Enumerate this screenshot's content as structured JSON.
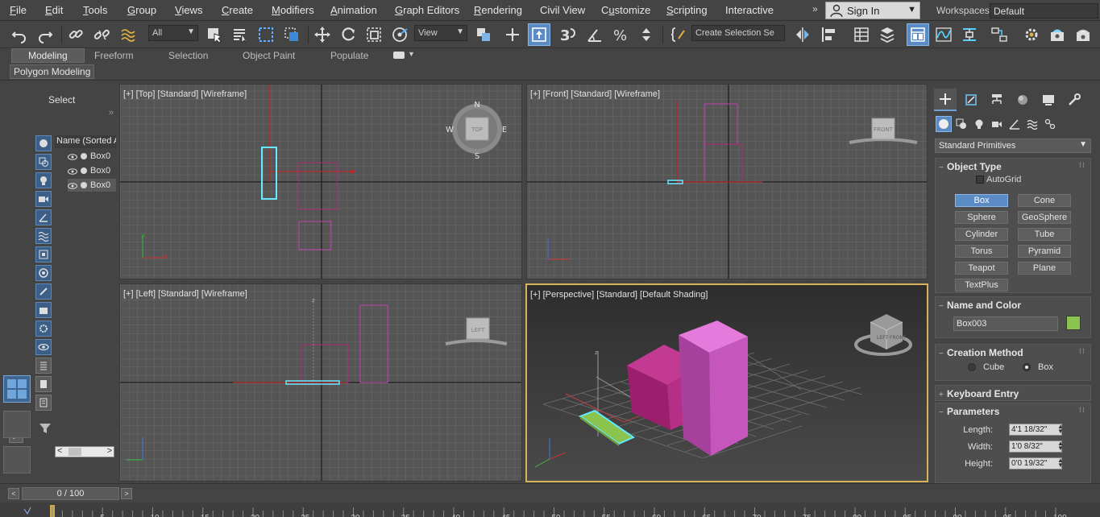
{
  "menu": {
    "items": [
      {
        "label": "File",
        "hot": "F"
      },
      {
        "label": "Edit",
        "hot": "E"
      },
      {
        "label": "Tools",
        "hot": "T"
      },
      {
        "label": "Group",
        "hot": "G"
      },
      {
        "label": "Views",
        "hot": "V"
      },
      {
        "label": "Create",
        "hot": "C"
      },
      {
        "label": "Modifiers",
        "hot": "M"
      },
      {
        "label": "Animation",
        "hot": "A"
      },
      {
        "label": "Graph Editors",
        "hot": "G"
      },
      {
        "label": "Rendering",
        "hot": "R"
      },
      {
        "label": "Civil View",
        "hot": ""
      },
      {
        "label": "Customize",
        "hot": "u"
      },
      {
        "label": "Scripting",
        "hot": "S"
      },
      {
        "label": "Interactive",
        "hot": ""
      }
    ],
    "overflow": "»",
    "signin": "Sign In",
    "workspaces_label": "Workspaces:",
    "workspaces_value": "Default"
  },
  "toolbar": {
    "filter_select": "All",
    "view_select": "View",
    "selection_set": "Create Selection Se",
    "snap_3": "3",
    "icons": [
      "undo-icon",
      "redo-icon",
      "link-icon",
      "unlink-icon",
      "bind-spacewarp-icon",
      "select-object-icon",
      "select-by-name-icon",
      "rect-region-icon",
      "window-crossing-icon",
      "move-icon",
      "rotate-icon",
      "scale-icon",
      "placement-icon",
      "pivot-icon",
      "manipulate-icon",
      "keyboard-shortcut-icon",
      "snap-toggle-icon",
      "angle-snap-icon",
      "percent-snap-icon",
      "spinner-snap-icon",
      "edit-named-sets-icon",
      "mirror-icon",
      "align-icon",
      "scene-explorer-icon",
      "layer-explorer-icon",
      "toggle-ribbon-icon",
      "curve-editor-icon",
      "schematic-view-icon",
      "material-editor-icon",
      "render-setup-icon",
      "rendered-frame-icon",
      "render-icon",
      "render-cloud-icon"
    ]
  },
  "ribbon": {
    "tabs": [
      "Modeling",
      "Freeform",
      "Selection",
      "Object Paint",
      "Populate"
    ],
    "active": "Modeling",
    "sub_label": "Polygon Modeling"
  },
  "explorer": {
    "title": "Select",
    "column_header": "Name (Sorted A",
    "rows": [
      "Box0",
      "Box0",
      "Box0"
    ],
    "selected_index": 2
  },
  "viewports": {
    "top": "[+] [Top] [Standard] [Wireframe]",
    "front": "[+] [Front] [Standard] [Wireframe]",
    "left": "[+] [Left] [Standard] [Wireframe]",
    "perspective": "[+] [Perspective] [Standard] [Default Shading]",
    "compass": {
      "n": "N",
      "s": "S",
      "e": "E",
      "w": "W",
      "cube_top": "TOP"
    },
    "viewcube_front": "FRONT",
    "viewcube_left": "LEFT",
    "viewcube_persp": [
      "LEFT",
      "FRONT"
    ],
    "axis_labels": {
      "x": "x",
      "y": "y",
      "z": "z"
    }
  },
  "command_panel": {
    "category_dropdown": "Standard Primitives",
    "object_type": {
      "title": "Object Type",
      "autogrid": "AutoGrid",
      "buttons": [
        "Box",
        "Cone",
        "Sphere",
        "GeoSphere",
        "Cylinder",
        "Tube",
        "Torus",
        "Pyramid",
        "Teapot",
        "Plane",
        "TextPlus"
      ],
      "active": "Box"
    },
    "name_and_color": {
      "title": "Name and Color",
      "name": "Box003",
      "color": "#8ac44f"
    },
    "creation_method": {
      "title": "Creation Method",
      "options": [
        "Cube",
        "Box"
      ],
      "selected": "Box"
    },
    "keyboard_entry": {
      "title": "Keyboard Entry"
    },
    "parameters": {
      "title": "Parameters",
      "fields": [
        {
          "label": "Length:",
          "value": "4'1 18/32\""
        },
        {
          "label": "Width:",
          "value": "1'0 8/32\""
        },
        {
          "label": "Height:",
          "value": "0'0 19/32\""
        }
      ]
    }
  },
  "timeline": {
    "slider": "0 / 100",
    "prev": "<",
    "next": ">",
    "ruler_labels": [
      "5",
      "10",
      "15",
      "20",
      "25",
      "30",
      "35",
      "40",
      "45",
      "50",
      "55",
      "60",
      "65",
      "70",
      "75",
      "80",
      "85",
      "90",
      "95",
      "100"
    ]
  },
  "colors": {
    "accent": "#5b8bc4",
    "selection_cyan": "#66e8ff",
    "box_magenta": "#c050b8",
    "box_pink": "#b52f86",
    "box_green": "#8ac44f",
    "active_viewport_border": "#d6b35a"
  }
}
